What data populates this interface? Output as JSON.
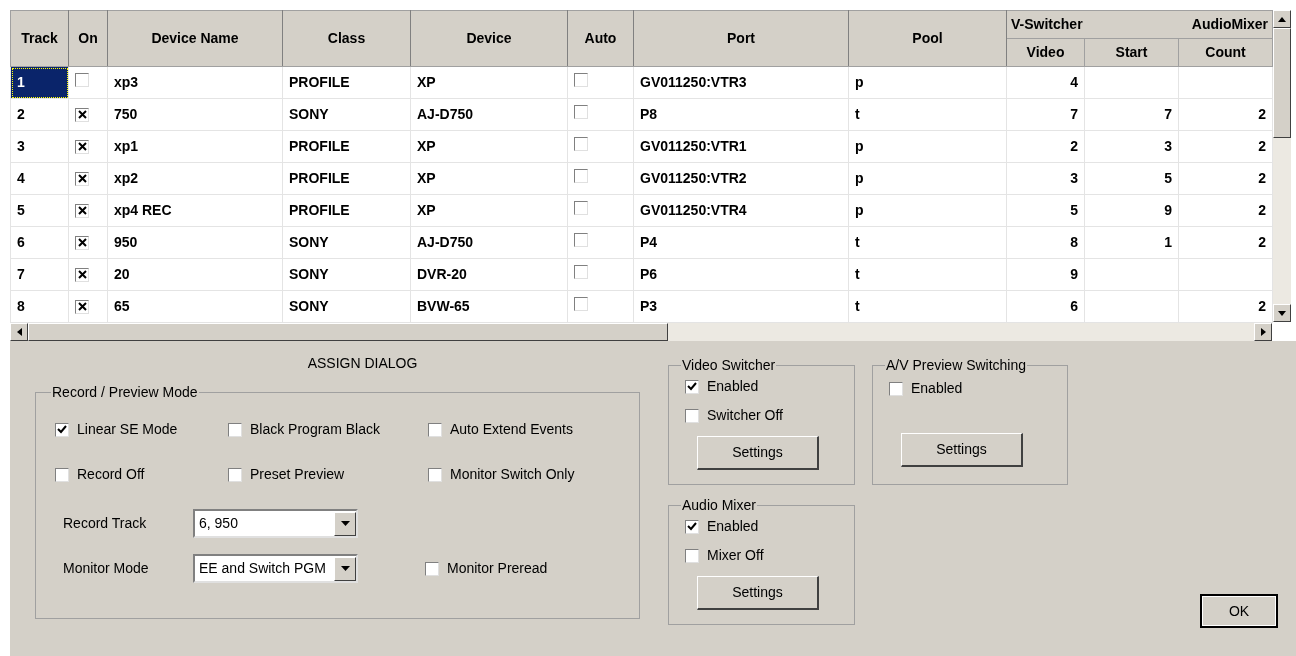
{
  "table": {
    "columns": [
      "Track",
      "On",
      "Device Name",
      "Class",
      "Device",
      "Auto",
      "Port",
      "Pool"
    ],
    "group_header": [
      "V-Switcher",
      "AudioMixer"
    ],
    "sub_columns": [
      "Video",
      "Start",
      "Count"
    ],
    "rows": [
      {
        "track": "1",
        "selected": true,
        "on": false,
        "device_name": "xp3",
        "class": "PROFILE",
        "device": "XP",
        "auto": false,
        "port": "GV011250:VTR3",
        "pool": "p",
        "video": "4"
      },
      {
        "track": "2",
        "selected": false,
        "on": true,
        "device_name": "750",
        "class": "SONY",
        "device": "AJ-D750",
        "auto": false,
        "port": "P8",
        "pool": "t",
        "video": "7",
        "start": "7",
        "count": "2"
      },
      {
        "track": "3",
        "selected": false,
        "on": true,
        "device_name": "xp1",
        "class": "PROFILE",
        "device": "XP",
        "auto": false,
        "port": "GV011250:VTR1",
        "pool": "p",
        "video": "2",
        "start": "3",
        "count": "2"
      },
      {
        "track": "4",
        "selected": false,
        "on": true,
        "device_name": "xp2",
        "class": "PROFILE",
        "device": "XP",
        "auto": false,
        "port": "GV011250:VTR2",
        "pool": "p",
        "video": "3",
        "start": "5",
        "count": "2"
      },
      {
        "track": "5",
        "selected": false,
        "on": true,
        "device_name": "xp4 REC",
        "class": "PROFILE",
        "device": "XP",
        "auto": false,
        "port": "GV011250:VTR4",
        "pool": "p",
        "video": "5",
        "start": "9",
        "count": "2"
      },
      {
        "track": "6",
        "selected": false,
        "on": true,
        "device_name": "950",
        "class": "SONY",
        "device": "AJ-D750",
        "auto": false,
        "port": "P4",
        "pool": "t",
        "video": "8",
        "start": "1",
        "count": "2"
      },
      {
        "track": "7",
        "selected": false,
        "on": true,
        "device_name": "20",
        "class": "SONY",
        "device": "DVR-20",
        "auto": false,
        "port": "P6",
        "pool": "t",
        "video": "9"
      },
      {
        "track": "8",
        "selected": false,
        "on": true,
        "device_name": "65",
        "class": "SONY",
        "device": "BVW-65",
        "auto": false,
        "port": "P3",
        "pool": "t",
        "video": "6",
        "count": "2"
      }
    ]
  },
  "dialog": {
    "title": "ASSIGN DIALOG",
    "record_preview": {
      "title": "Record / Preview Mode",
      "options": [
        {
          "label": "Linear SE Mode",
          "checked": true
        },
        {
          "label": "Black Program Black",
          "checked": false
        },
        {
          "label": "Auto Extend Events",
          "checked": false
        },
        {
          "label": "Record Off",
          "checked": false
        },
        {
          "label": "Preset Preview",
          "checked": false
        },
        {
          "label": "Monitor Switch Only",
          "checked": false
        }
      ],
      "record_track": {
        "label": "Record Track",
        "value": "6, 950"
      },
      "monitor_mode": {
        "label": "Monitor Mode",
        "value": "EE and Switch PGM"
      },
      "monitor_preread": {
        "label": "Monitor Preread",
        "checked": false
      }
    },
    "video_switcher": {
      "title": "Video Switcher",
      "options": [
        {
          "label": "Enabled",
          "checked": true
        },
        {
          "label": "Switcher Off",
          "checked": false
        }
      ],
      "button": "Settings"
    },
    "audio_mixer": {
      "title": "Audio Mixer",
      "options": [
        {
          "label": "Enabled",
          "checked": true
        },
        {
          "label": "Mixer Off",
          "checked": false
        }
      ],
      "button": "Settings"
    },
    "av_preview": {
      "title": "A/V Preview Switching",
      "options": [
        {
          "label": "Enabled",
          "checked": false
        }
      ],
      "button": "Settings"
    },
    "ok_button": "OK"
  }
}
